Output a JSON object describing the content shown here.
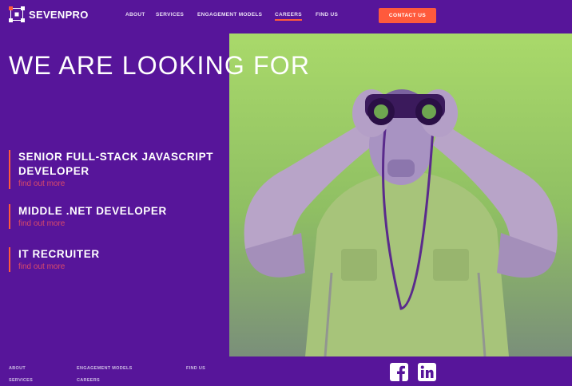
{
  "brand": {
    "name": "SEVENPRO"
  },
  "nav": {
    "items": [
      {
        "label": "ABOUT",
        "active": false
      },
      {
        "label": "SERVICES",
        "active": false
      },
      {
        "label": "ENGAGEMENT MODELS",
        "active": false
      },
      {
        "label": "CAREERS",
        "active": true
      },
      {
        "label": "FIND US",
        "active": false
      }
    ],
    "contact_label": "CONTACT US"
  },
  "hero": {
    "headline": "WE ARE LOOKING FOR"
  },
  "jobs": [
    {
      "title": "SENIOR FULL-STACK JAVASCRIPT DEVELOPER",
      "link": "find out more"
    },
    {
      "title": "MIDDLE .NET DEVELOPER",
      "link": "find out more"
    },
    {
      "title": "IT RECRUITER",
      "link": "find out more"
    }
  ],
  "footer": {
    "links": [
      "ABOUT",
      "SERVICES",
      "ENGAGEMENT MODELS",
      "CAREERS",
      "FIND US"
    ],
    "social": [
      "facebook-icon",
      "linkedin-icon"
    ]
  },
  "colors": {
    "background": "#57159a",
    "accent": "#ff5a3c",
    "link": "#d94a69",
    "image_tint": "#9ccc5f"
  }
}
